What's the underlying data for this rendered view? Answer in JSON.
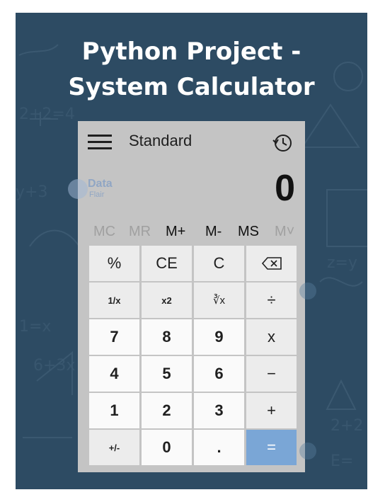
{
  "title": {
    "line1": "Python Project -",
    "line2": "System Calculator"
  },
  "calculator": {
    "menu_icon": "hamburger-menu-icon",
    "mode_label": "Standard",
    "history_icon": "history-clock-icon",
    "display_value": "0",
    "watermark": {
      "line1": "Data",
      "line2": "Flair"
    },
    "memory": [
      {
        "label": "MC",
        "enabled": false
      },
      {
        "label": "MR",
        "enabled": false
      },
      {
        "label": "M+",
        "enabled": true
      },
      {
        "label": "M-",
        "enabled": true
      },
      {
        "label": "MS",
        "enabled": true
      },
      {
        "label": "M˅",
        "enabled": false
      }
    ],
    "keys": [
      [
        "%",
        "CE",
        "C",
        "⌫"
      ],
      [
        "1/x",
        "x2",
        "∛x",
        "÷"
      ],
      [
        "7",
        "8",
        "9",
        "x"
      ],
      [
        "4",
        "5",
        "6",
        "−"
      ],
      [
        "1",
        "2",
        "3",
        "+"
      ],
      [
        "+/-",
        "0",
        ".",
        "="
      ]
    ],
    "accent_color": "#7aa6d6",
    "background_color": "#2d4b63"
  }
}
